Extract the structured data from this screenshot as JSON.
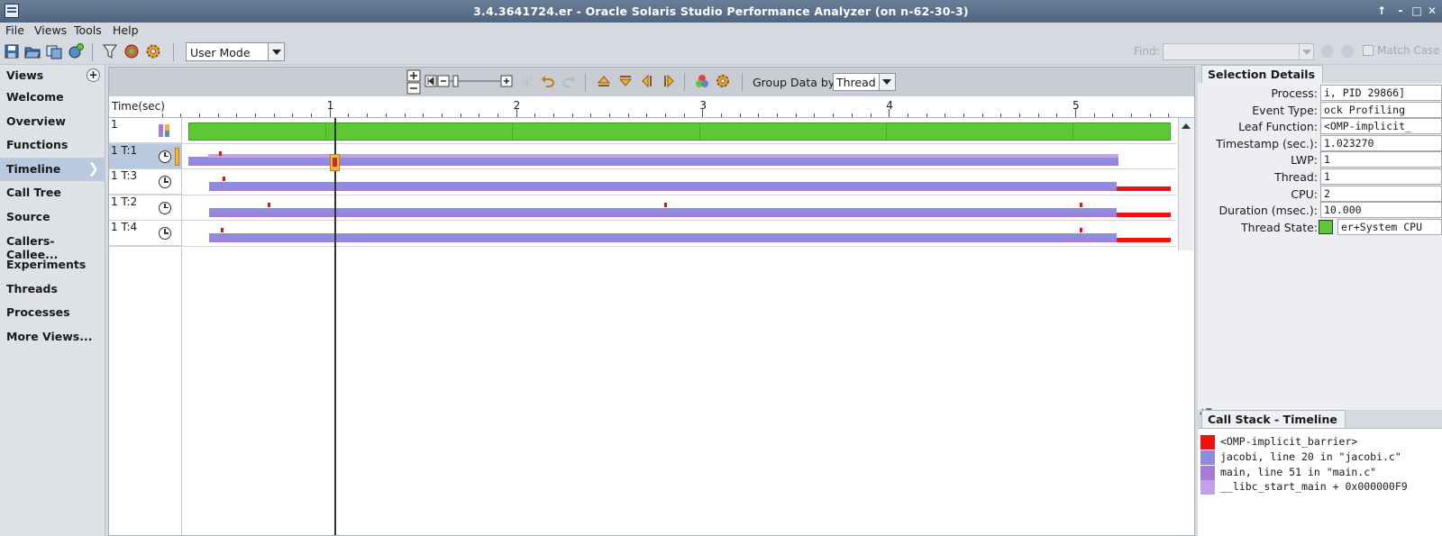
{
  "window": {
    "title": "3.4.3641724.er  -  Oracle Solaris Studio Performance Analyzer (on n-62-30-3)",
    "controls": [
      "↑",
      "⁃",
      "□",
      "✕"
    ]
  },
  "menubar": {
    "items": [
      "File",
      "Views",
      "Tools",
      "Help"
    ]
  },
  "toolbar": {
    "mode_value": "User Mode",
    "find_label": "Find:",
    "find_value": "",
    "match_case_label": "Match Case"
  },
  "views": {
    "header": "Views",
    "add_label": "+",
    "items": [
      {
        "label": "Welcome",
        "selected": false
      },
      {
        "label": "Overview",
        "selected": false
      },
      {
        "label": "Functions",
        "selected": false
      },
      {
        "label": "Timeline",
        "selected": true
      },
      {
        "label": "Call Tree",
        "selected": false
      },
      {
        "label": "Source",
        "selected": false
      },
      {
        "label": "Callers-Callee...",
        "selected": false
      },
      {
        "label": "Experiments",
        "selected": false
      },
      {
        "label": "Threads",
        "selected": false
      },
      {
        "label": "Processes",
        "selected": false
      },
      {
        "label": "More Views...",
        "selected": false
      }
    ],
    "selected_chevron": "❯"
  },
  "timeline": {
    "group_label": "Group Data by:",
    "group_value": "Thread",
    "axis_title": "Time(sec)",
    "axis_labels": [
      "1",
      "2",
      "3",
      "4",
      "5"
    ],
    "axis_max_sec": 5.5,
    "cursor_sec": 1.02327,
    "rows": [
      {
        "label": "1",
        "kind": "summary",
        "selected": false
      },
      {
        "label": "1 T:1",
        "kind": "thread",
        "selected": true
      },
      {
        "label": "1 T:3",
        "kind": "thread",
        "selected": false
      },
      {
        "label": "1 T:2",
        "kind": "thread",
        "selected": false
      },
      {
        "label": "1 T:4",
        "kind": "thread",
        "selected": false
      }
    ]
  },
  "colors": {
    "user_cpu": "#5cc832",
    "barrier": "#ee1111",
    "jacobi": "#8f8ce0",
    "main": "#a77bd8",
    "libc_start": "#c4a0ea"
  },
  "selection_details": {
    "tab": "Selection Details",
    "fields": [
      {
        "label": "Process:",
        "value": "i, PID 29866]"
      },
      {
        "label": "Event Type:",
        "value": "ock Profiling"
      },
      {
        "label": "Leaf Function:",
        "value": "<OMP-implicit_"
      },
      {
        "label": "Timestamp (sec.):",
        "value": "1.023270"
      },
      {
        "label": "LWP:",
        "value": "1"
      },
      {
        "label": "Thread:",
        "value": "1"
      },
      {
        "label": "CPU:",
        "value": "2"
      },
      {
        "label": "Duration (msec.):",
        "value": "10.000"
      },
      {
        "label": "Thread State:",
        "value": "er+System CPU"
      }
    ]
  },
  "call_stack": {
    "tab": "Call Stack - Timeline",
    "frames": [
      {
        "text": "<OMP-implicit_barrier>",
        "color": "#ee1111"
      },
      {
        "text": "jacobi, line 20 in \"jacobi.c\"",
        "color": "#8f8ce0"
      },
      {
        "text": "main, line 51 in \"main.c\"",
        "color": "#a77bd8"
      },
      {
        "text": "__libc_start_main + 0x000000F9",
        "color": "#c4a0ea"
      }
    ]
  }
}
